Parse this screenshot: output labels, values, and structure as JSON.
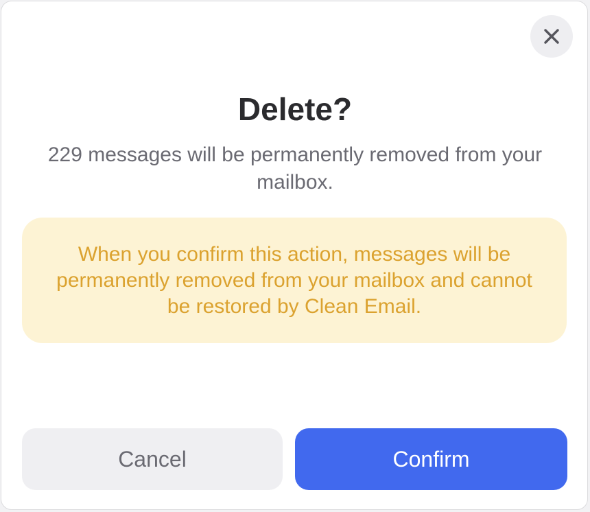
{
  "dialog": {
    "title": "Delete?",
    "message": "229 messages will be permanently removed from your mailbox.",
    "warning": "When you confirm this action, messages will be permanently removed from your mailbox and cannot be restored by Clean Email.",
    "close_icon": "close-icon",
    "buttons": {
      "cancel_label": "Cancel",
      "confirm_label": "Confirm"
    }
  },
  "colors": {
    "accent": "#4169ee",
    "warning_background": "#fdf3d4",
    "warning_text": "#dba22f"
  }
}
